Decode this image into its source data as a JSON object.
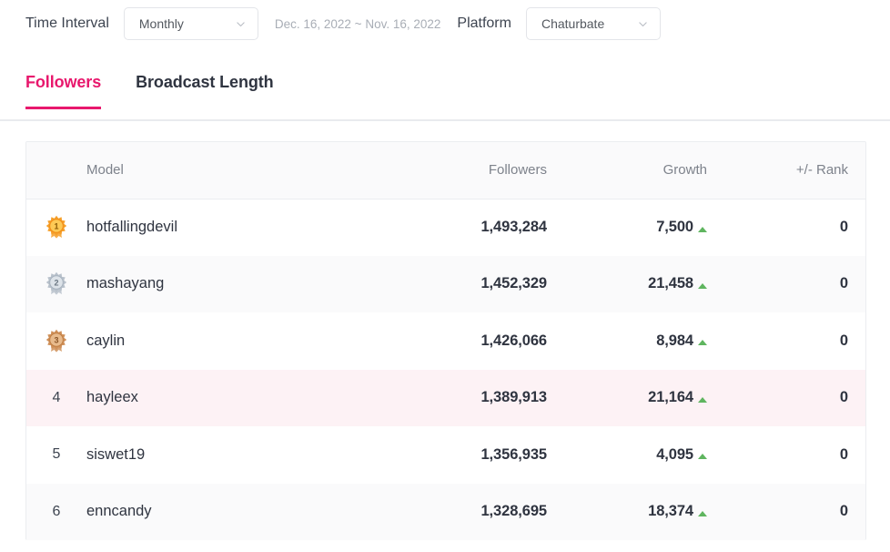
{
  "filters": {
    "time_interval_label": "Time Interval",
    "time_interval_value": "Monthly",
    "date_range": "Dec. 16, 2022 ~ Nov. 16, 2022",
    "platform_label": "Platform",
    "platform_value": "Chaturbate"
  },
  "tabs": [
    {
      "label": "Followers",
      "active": true
    },
    {
      "label": "Broadcast Length",
      "active": false
    }
  ],
  "table": {
    "columns": {
      "rank": "",
      "model": "Model",
      "followers": "Followers",
      "growth": "Growth",
      "delta_rank": "+/- Rank"
    },
    "rows": [
      {
        "rank": "1",
        "medal": "gold-medal-icon",
        "model": "hotfallingdevil",
        "followers": "1,493,284",
        "growth": "7,500",
        "growth_dir": "up",
        "delta_rank": "0",
        "highlight": false
      },
      {
        "rank": "2",
        "medal": "silver-medal-icon",
        "model": "mashayang",
        "followers": "1,452,329",
        "growth": "21,458",
        "growth_dir": "up",
        "delta_rank": "0",
        "highlight": false
      },
      {
        "rank": "3",
        "medal": "bronze-medal-icon",
        "model": "caylin",
        "followers": "1,426,066",
        "growth": "8,984",
        "growth_dir": "up",
        "delta_rank": "0",
        "highlight": false
      },
      {
        "rank": "4",
        "medal": null,
        "model": "hayleex",
        "followers": "1,389,913",
        "growth": "21,164",
        "growth_dir": "up",
        "delta_rank": "0",
        "highlight": true
      },
      {
        "rank": "5",
        "medal": null,
        "model": "siswet19",
        "followers": "1,356,935",
        "growth": "4,095",
        "growth_dir": "up",
        "delta_rank": "0",
        "highlight": false
      },
      {
        "rank": "6",
        "medal": null,
        "model": "enncandy",
        "followers": "1,328,695",
        "growth": "18,374",
        "growth_dir": "up",
        "delta_rank": "0",
        "highlight": false
      }
    ]
  },
  "colors": {
    "accent_pink": "#e8186d",
    "growth_up_green": "#5fb55f",
    "highlight_row": "#fdf2f5",
    "gold": "#f5a623",
    "silver": "#b6bec8",
    "bronze": "#cd8d56"
  }
}
